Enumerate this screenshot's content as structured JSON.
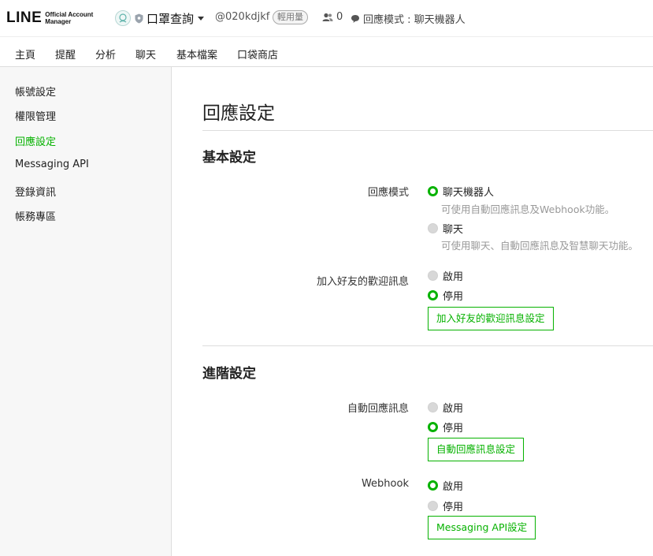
{
  "header": {
    "logo_text": "LINE",
    "logo_sub_line1": "Official Account",
    "logo_sub_line2": "Manager",
    "account_name": "口罩查詢",
    "account_id": "@020kdjkf",
    "plan_badge": "輕用量",
    "friend_count": "0",
    "response_mode": "回應模式 : 聊天機器人"
  },
  "tabs": [
    "主頁",
    "提醒",
    "分析",
    "聊天",
    "基本檔案",
    "口袋商店"
  ],
  "sidebar": {
    "items": [
      {
        "label": "帳號設定"
      },
      {
        "label": "權限管理"
      },
      {
        "label": "回應設定"
      },
      {
        "label": "Messaging API"
      },
      {
        "label": "登錄資訊"
      },
      {
        "label": "帳務專區"
      }
    ],
    "active": "回應設定"
  },
  "main": {
    "title": "回應設定",
    "basic": {
      "title": "基本設定",
      "response_mode_label": "回應模式",
      "opt_bot": "聊天機器人",
      "opt_bot_hint": "可使用自動回應訊息及Webhook功能。",
      "opt_chat": "聊天",
      "opt_chat_hint": "可使用聊天、自動回應訊息及智慧聊天功能。",
      "selected_mode": "聊天機器人",
      "welcome_label": "加入好友的歡迎訊息",
      "welcome_on": "啟用",
      "welcome_off": "停用",
      "welcome_selected": "停用",
      "welcome_button": "加入好友的歡迎訊息設定"
    },
    "advanced": {
      "title": "進階設定",
      "auto_label": "自動回應訊息",
      "auto_on": "啟用",
      "auto_off": "停用",
      "auto_selected": "停用",
      "auto_button": "自動回應訊息設定",
      "webhook_label": "Webhook",
      "webhook_on": "啟用",
      "webhook_off": "停用",
      "webhook_selected": "啟用",
      "webhook_button": "Messaging API設定"
    }
  },
  "colors": {
    "accent": "#06b200",
    "sidebar_bg": "#f7f7f7",
    "hint": "#999999"
  }
}
